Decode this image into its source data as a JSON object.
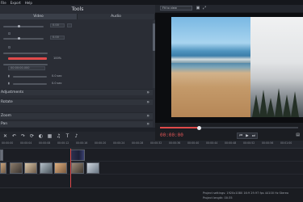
{
  "menu": [
    "File",
    "Export",
    "Help"
  ],
  "tools": {
    "title": "Tools",
    "tabs": [
      "Video",
      "Audio"
    ],
    "values": [
      "0.00",
      "0.00",
      "100%",
      "00:00:00.000",
      "0.0 sec",
      "0.0 sec"
    ],
    "sections": [
      {
        "label": "Adjustments"
      },
      {
        "label": "Rotate"
      },
      {
        "label": "Zoom"
      },
      {
        "label": "Pan"
      }
    ]
  },
  "preview": {
    "aspect_select": "Fit to view",
    "timecode": "00:00:00",
    "play_controls": [
      "⏮",
      "▶",
      "⏭"
    ]
  },
  "timeline": {
    "ruler": [
      "00:00:00",
      "00:00:04",
      "00:00:08",
      "00:00:12",
      "00:00:16",
      "00:00:20",
      "00:00:24",
      "00:00:28",
      "00:00:32",
      "00:00:36",
      "00:00:40",
      "00:00:44",
      "00:00:48",
      "00:00:52",
      "00:00:56",
      "00:01:00"
    ],
    "toolbar_icons": [
      "cut-icon",
      "undo-icon",
      "redo-icon",
      "rotate-icon",
      "color-icon",
      "crop-icon",
      "audio-icon",
      "text-icon"
    ]
  },
  "status": {
    "settings": "Project settings: 1920x1080 16:9 29.97 fps 44100 Hz Stereo",
    "length": "Project length: 00:35"
  },
  "colors": {
    "accent": "#e04a4a",
    "panel": "#2a2d35",
    "background": "#1e2128"
  }
}
